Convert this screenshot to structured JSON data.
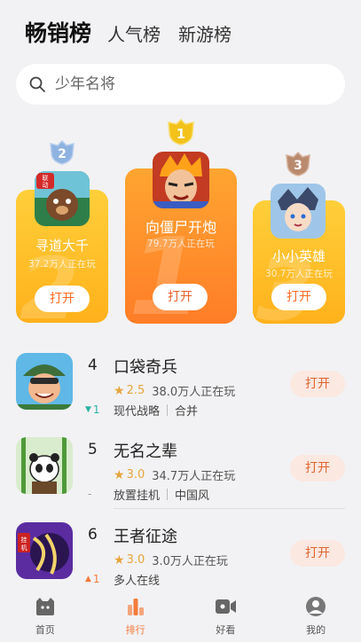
{
  "tabs": [
    {
      "label": "畅销榜",
      "active": true
    },
    {
      "label": "人气榜",
      "active": false
    },
    {
      "label": "新游榜",
      "active": false
    }
  ],
  "search": {
    "placeholder": "少年名将"
  },
  "podium": [
    {
      "rank": "1",
      "name": "向僵尸开炮",
      "players": "79.7万人正在玩",
      "button": "打开",
      "badge_color": "#f2c21a"
    },
    {
      "rank": "2",
      "name": "寻道大千",
      "players": "37.2万人正在玩",
      "button": "打开",
      "badge_color": "#8fb3e0",
      "icon_tag": "联动"
    },
    {
      "rank": "3",
      "name": "小小英雄",
      "players": "30.7万人正在玩",
      "button": "打开",
      "badge_color": "#b98a6e"
    }
  ],
  "list": [
    {
      "rank": "4",
      "name": "口袋奇兵",
      "score": "2.5",
      "players": "38.0万人正在玩",
      "tags": [
        "现代战略",
        "合并"
      ],
      "trend": "1",
      "trend_dir": "up",
      "button": "打开"
    },
    {
      "rank": "5",
      "name": "无名之辈",
      "score": "3.0",
      "players": "34.7万人正在玩",
      "tags": [
        "放置挂机",
        "中国风"
      ],
      "trend": "-",
      "trend_dir": "none",
      "button": "打开"
    },
    {
      "rank": "6",
      "name": "王者征途",
      "score": "3.0",
      "players": "3.0万人正在玩",
      "tags": [
        "多人在线"
      ],
      "trend": "1",
      "trend_dir": "hot",
      "button": "打开",
      "icon_tag": "挂机"
    }
  ],
  "nav": [
    {
      "label": "首页",
      "icon": "home-icon",
      "active": false
    },
    {
      "label": "排行",
      "icon": "rank-icon",
      "active": true
    },
    {
      "label": "好看",
      "icon": "video-icon",
      "active": false
    },
    {
      "label": "我的",
      "icon": "profile-icon",
      "active": false
    }
  ],
  "colors": {
    "accent": "#f27b3a",
    "card_gold": "#ffb11b",
    "card_orange": "#ff7d27",
    "star": "#e6a43b"
  }
}
